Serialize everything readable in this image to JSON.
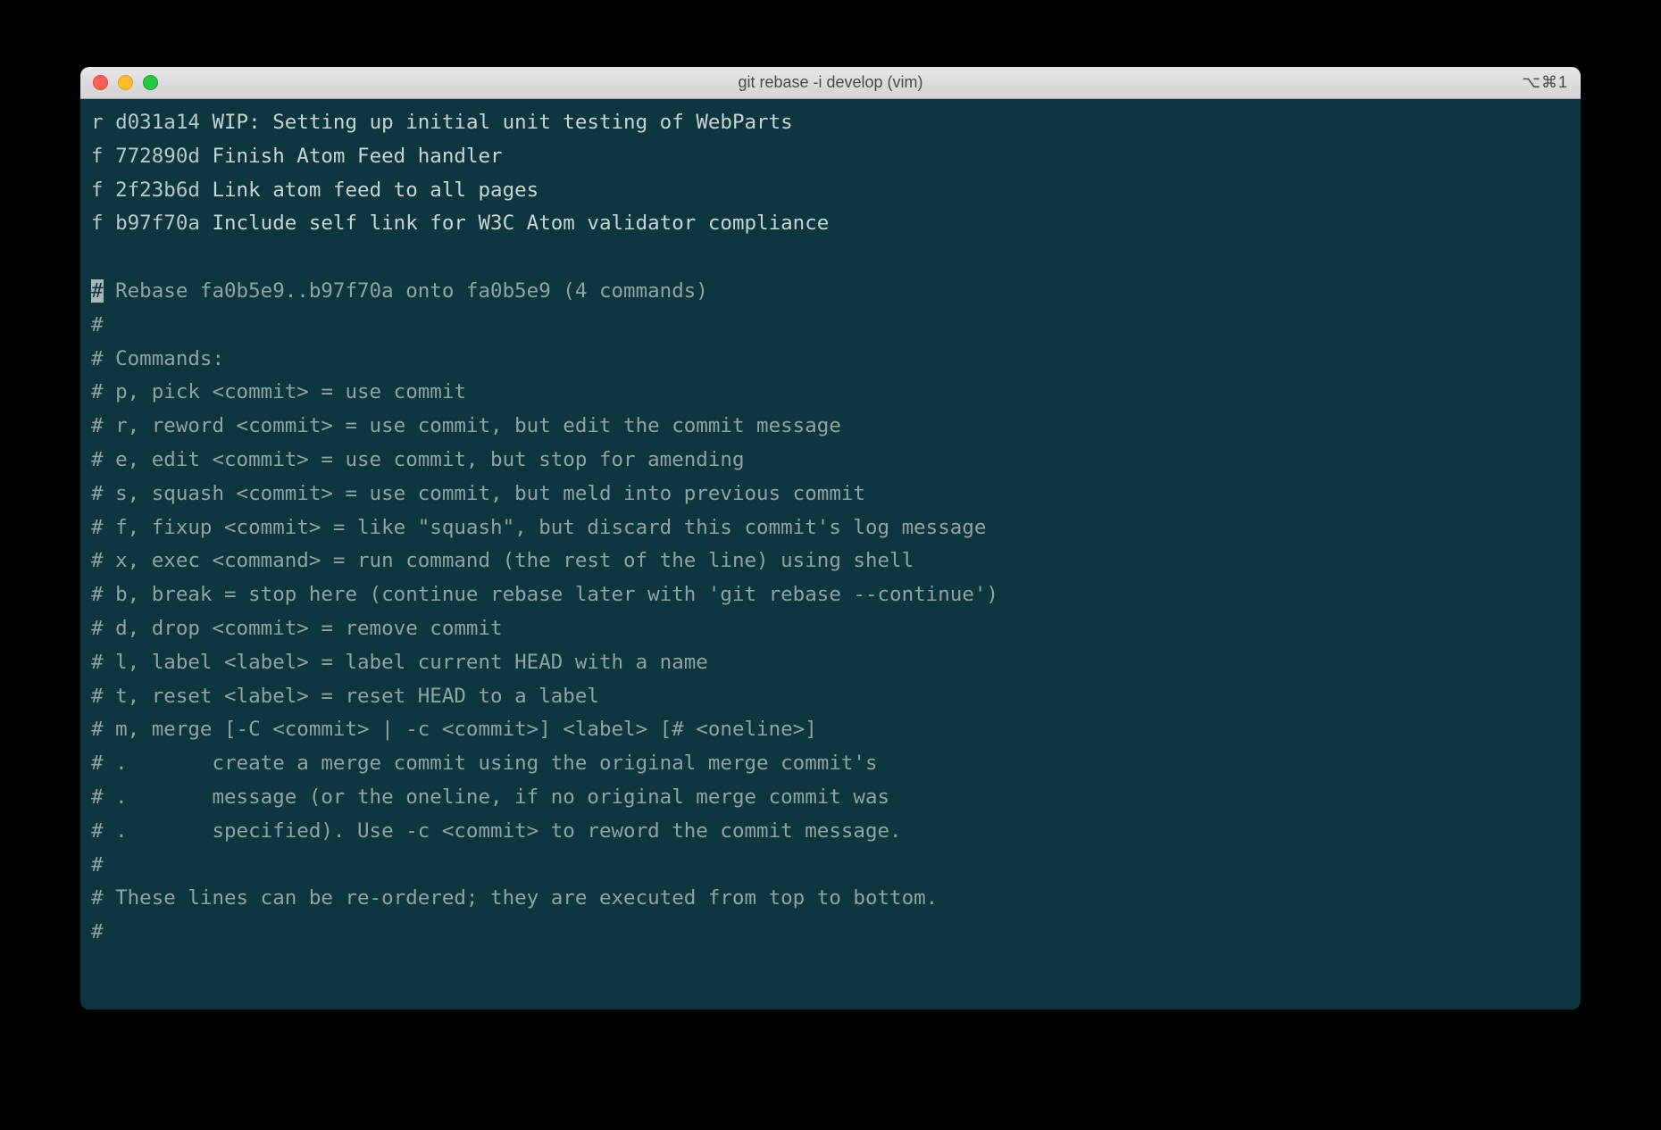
{
  "window": {
    "title": "git rebase -i develop (vim)",
    "shortcut": "⌥⌘1"
  },
  "commits": [
    {
      "action": "r",
      "hash": "d031a14",
      "msg": "WIP: Setting up initial unit testing of WebParts"
    },
    {
      "action": "f",
      "hash": "772890d",
      "msg": "Finish Atom Feed handler"
    },
    {
      "action": "f",
      "hash": "2f23b6d",
      "msg": "Link atom feed to all pages"
    },
    {
      "action": "f",
      "hash": "b97f70a",
      "msg": "Include self link for W3C Atom validator compliance"
    }
  ],
  "cursor": {
    "char": "#",
    "rest": " Rebase fa0b5e9..b97f70a onto fa0b5e9 (4 commands)"
  },
  "comments": [
    "#",
    "# Commands:",
    "# p, pick <commit> = use commit",
    "# r, reword <commit> = use commit, but edit the commit message",
    "# e, edit <commit> = use commit, but stop for amending",
    "# s, squash <commit> = use commit, but meld into previous commit",
    "# f, fixup <commit> = like \"squash\", but discard this commit's log message",
    "# x, exec <command> = run command (the rest of the line) using shell",
    "# b, break = stop here (continue rebase later with 'git rebase --continue')",
    "# d, drop <commit> = remove commit",
    "# l, label <label> = label current HEAD with a name",
    "# t, reset <label> = reset HEAD to a label",
    "# m, merge [-C <commit> | -c <commit>] <label> [# <oneline>]",
    "# .       create a merge commit using the original merge commit's",
    "# .       message (or the oneline, if no original merge commit was",
    "# .       specified). Use -c <commit> to reword the commit message.",
    "#",
    "# These lines can be re-ordered; they are executed from top to bottom.",
    "#"
  ]
}
